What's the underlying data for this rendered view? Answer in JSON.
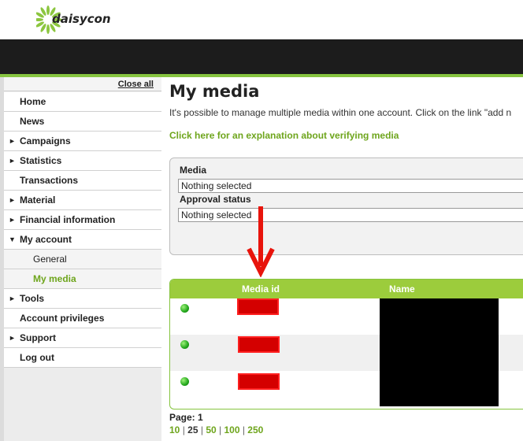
{
  "brand": {
    "logo_text": "daisycon",
    "accent_color": "#86c440",
    "link_color": "#6ea51c"
  },
  "sidebar": {
    "close_all_label": "Close all",
    "items": [
      {
        "label": "Home",
        "expandable": false
      },
      {
        "label": "News",
        "expandable": false
      },
      {
        "label": "Campaigns",
        "expandable": true
      },
      {
        "label": "Statistics",
        "expandable": true
      },
      {
        "label": "Transactions",
        "expandable": false
      },
      {
        "label": "Material",
        "expandable": true
      },
      {
        "label": "Financial information",
        "expandable": true
      },
      {
        "label": "My account",
        "expandable": true,
        "expanded": true
      },
      {
        "label": "General",
        "sub": true
      },
      {
        "label": "My media",
        "sub": true,
        "active": true
      },
      {
        "label": "Tools",
        "expandable": true
      },
      {
        "label": "Account privileges",
        "expandable": false
      },
      {
        "label": "Support",
        "expandable": true
      },
      {
        "label": "Log out",
        "expandable": false
      }
    ]
  },
  "main": {
    "title": "My media",
    "intro": "It's possible to manage multiple media within one account. Click on the link \"add n",
    "verify_link": "Click here for an explanation about verifying media",
    "filters": {
      "media_label": "Media",
      "media_value": "Nothing selected",
      "approval_label": "Approval status",
      "approval_value": "Nothing selected"
    },
    "table": {
      "columns": [
        "Media id",
        "Name"
      ],
      "rows": [
        {
          "status": "green-dot-icon",
          "media_id": "",
          "name": ""
        },
        {
          "status": "green-dot-icon",
          "media_id": "",
          "name": ""
        },
        {
          "status": "green-dot-icon",
          "media_id": "",
          "name": ""
        }
      ]
    },
    "pager": {
      "page_label": "Page: 1",
      "sizes": [
        "10",
        "25",
        "50",
        "100",
        "250"
      ],
      "current_size": "25"
    }
  },
  "annotation": {
    "arrow_color": "#e8140c"
  }
}
